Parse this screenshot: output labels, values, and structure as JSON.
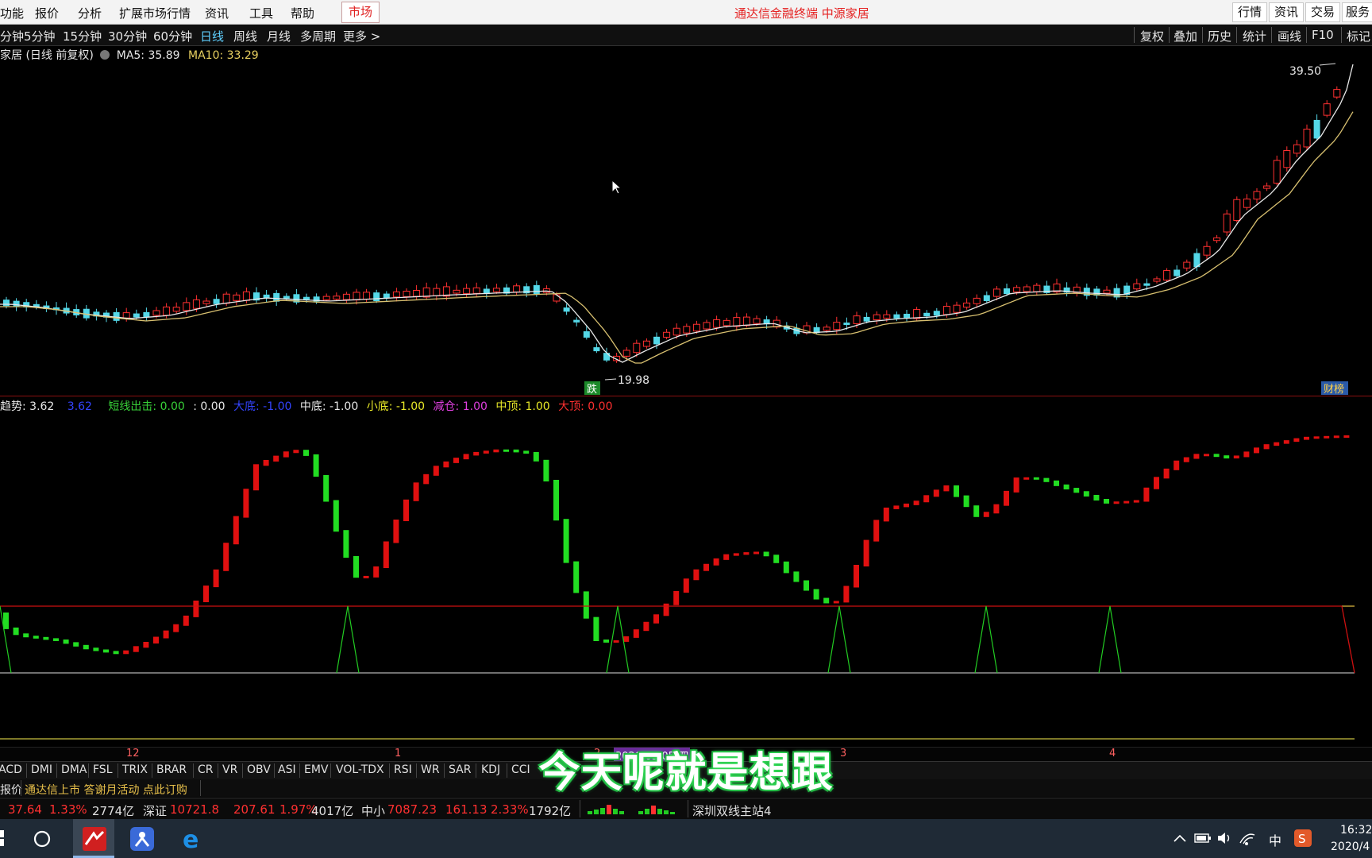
{
  "menu": {
    "items": [
      "功能",
      "报价",
      "分析",
      "扩展市场行情",
      "资讯",
      "工具",
      "帮助"
    ],
    "market_tab": "市场",
    "title": "通达信金融终端  中源家居",
    "right_buttons": [
      "行情",
      "资讯",
      "交易",
      "服务"
    ]
  },
  "periods": {
    "items": [
      "分钟",
      "5分钟",
      "15分钟",
      "30分钟",
      "60分钟",
      "日线",
      "周线",
      "月线",
      "多周期",
      "更多 >"
    ],
    "active": "日线",
    "tools": [
      "复权",
      "叠加",
      "历史",
      "统计",
      "画线",
      "F10",
      "标记"
    ]
  },
  "main_panel": {
    "stock_label": "家居 (日线 前复权)",
    "ma5_label": "MA5: 35.89",
    "ma10_label": "MA10: 33.29",
    "high_label": "39.50",
    "low_label": "19.98",
    "fall_badge": "跌",
    "report_badge": "财榜"
  },
  "indicator_panel": {
    "legend": [
      {
        "text": "趋势: 3.62",
        "color": "#e8e8e8"
      },
      {
        "text": "3.62",
        "color": "#3344ff"
      },
      {
        "text": "短线出击: 0.00",
        "color": "#38d038"
      },
      {
        "text": ": 0.00",
        "color": "#e8e8e8"
      },
      {
        "text": "大底: -1.00",
        "color": "#3344ff"
      },
      {
        "text": "中底: -1.00",
        "color": "#e8e8e8"
      },
      {
        "text": "小底: -1.00",
        "color": "#e8e828"
      },
      {
        "text": "减仓: 1.00",
        "color": "#e040e0"
      },
      {
        "text": "中顶: 1.00",
        "color": "#e8e828"
      },
      {
        "text": "大顶: 0.00",
        "color": "#ff3030"
      }
    ]
  },
  "time_axis": {
    "labels": [
      "12",
      "1",
      "2",
      "3",
      "4"
    ],
    "overlay_date": "2020/03/05/四"
  },
  "bottom_tabs": [
    "MACD",
    "DMI",
    "DMA",
    "FSL",
    "TRIX",
    "BRAR",
    "CR",
    "VR",
    "OBV",
    "ASI",
    "EMV",
    "VOL-TDX",
    "RSI",
    "WR",
    "SAR",
    "KDJ",
    "CCI"
  ],
  "news": {
    "left": "报价",
    "text": "通达信上市 答谢月活动 点此订购"
  },
  "index_bar": {
    "first": {
      "value": "37.64",
      "pct": "1.33%",
      "amount": "2774亿"
    },
    "sz": {
      "name": "深证",
      "value": "10721.8",
      "change": "207.61",
      "pct": "1.97%",
      "amount": "4017亿"
    },
    "zx": {
      "name": "中小",
      "value": "7087.23",
      "change": "161.13",
      "pct": "2.33%",
      "amount": "1792亿"
    },
    "station": "深圳双线主站4"
  },
  "taskbar": {
    "tray_ime": "中",
    "time": "16:32",
    "date": "2020/4"
  },
  "subtitle": "今天呢就是想跟",
  "colors": {
    "up": "#ff3030",
    "down": "#54d8e8",
    "ma5": "#e8e8e8",
    "ma10": "#d8c070",
    "ind_up": "#e01010",
    "ind_down": "#22dd22"
  },
  "chart_data": {
    "type": "candlestick",
    "ma5": 35.89,
    "ma10": 33.29,
    "high": 39.5,
    "low": 19.98,
    "indicator": {
      "trend": 3.62,
      "短线出击": 0.0,
      "大底": -1.0,
      "中底": -1.0,
      "小底": -1.0,
      "减仓": 1.0,
      "中顶": 1.0,
      "大顶": 0.0
    }
  }
}
